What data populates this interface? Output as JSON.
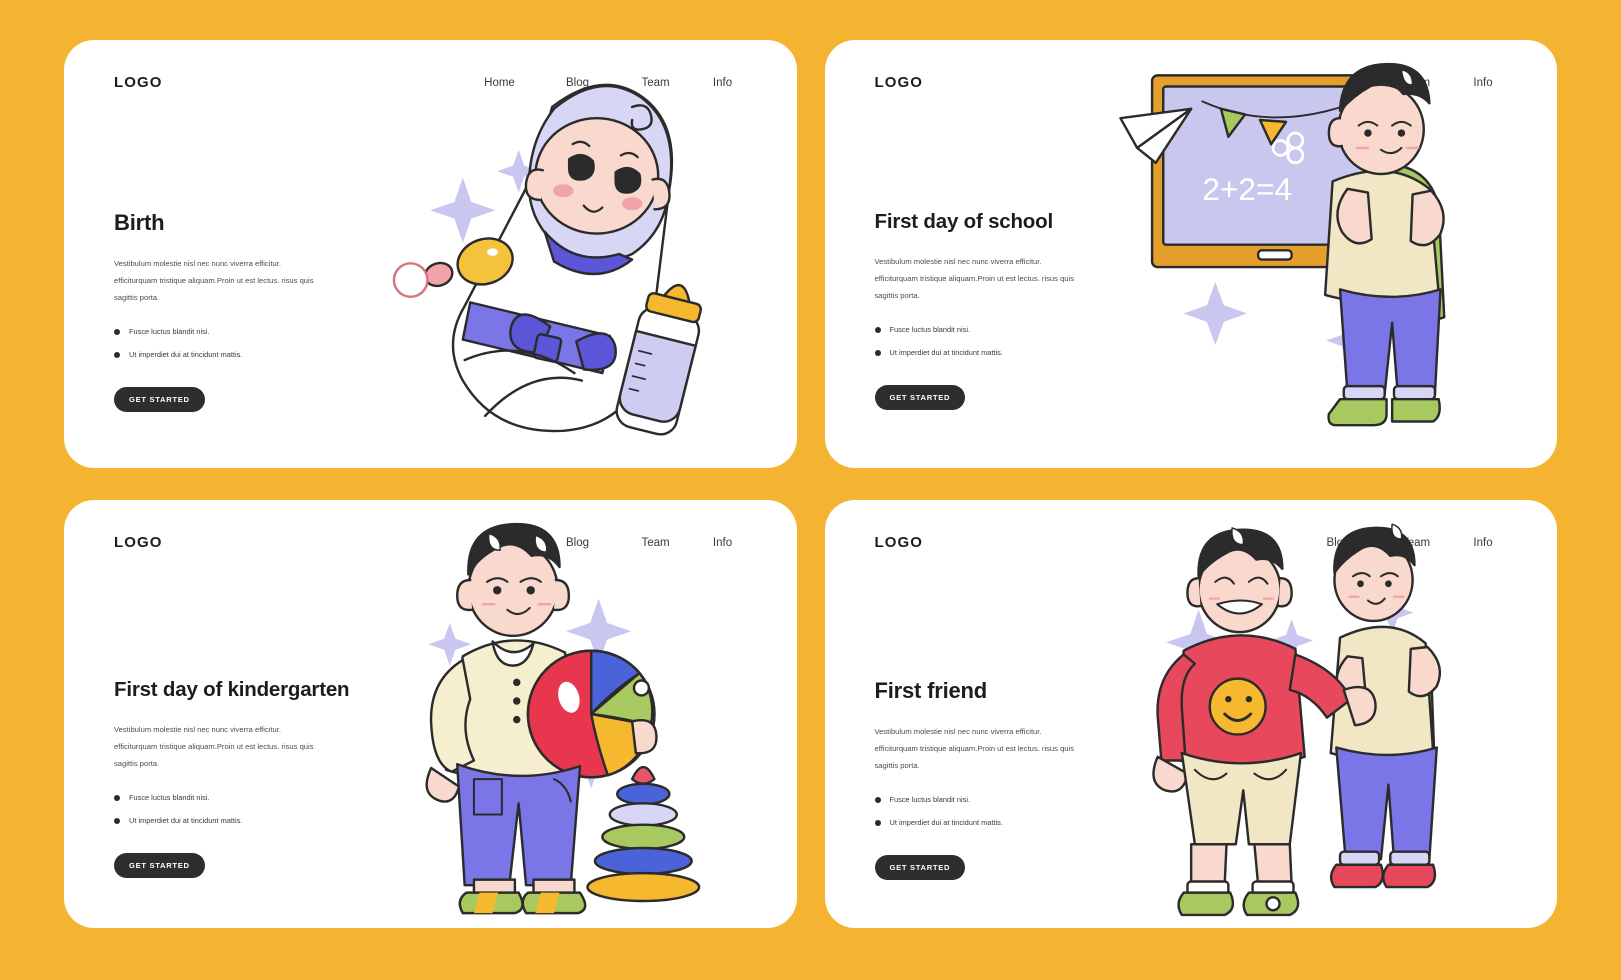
{
  "background_color": "#F4B431",
  "card_color": "#FFFFFF",
  "shared": {
    "logo": "LOGO",
    "nav": [
      "Home",
      "Blog",
      "Team",
      "Info"
    ],
    "paragraph": "Vestibulum molestie nisl nec nunc viverra efficitur. efficiturquam tristique aliquam.Proin ut est lectus. risus quis sagittis porta.",
    "bullets": [
      "Fusce luctus blandit nisi.",
      "Ut imperdiet dui at tincidunt mattis."
    ],
    "cta_label": "GET STARTED",
    "cta_color": "#2E2E2E"
  },
  "cards": [
    {
      "id": "birth",
      "title": "Birth",
      "illustration": "swaddled-baby-with-pacifier-and-bottle",
      "colors": {
        "swaddle": "#FFFFFF",
        "hood": "#D7D6F5",
        "ribbon": "#7B76E8",
        "pacifier": "#F5C33B",
        "pacifier_ring": "#E8808C",
        "bottle_nipple": "#F5B82E",
        "bottle_liquid": "#CFCCF2",
        "skin": "#F9D9CE",
        "sparkle": "#C9C6F0"
      }
    },
    {
      "id": "first-day-of-school",
      "title": "First day of school",
      "illustration": "boy-with-backpack-at-chalkboard",
      "chalkboard_text": "2+2=4",
      "colors": {
        "board_frame": "#E5A02C",
        "board_face": "#C9C7EE",
        "shirt": "#F2E7C4",
        "pants": "#7B76E8",
        "backpack": "#A8C95F",
        "shoes": "#A8C95F",
        "hair": "#2B2B2B",
        "bunting": [
          "#A8C95F",
          "#F5B82E",
          "#E8556A"
        ],
        "sparkle": "#C9C6F0"
      }
    },
    {
      "id": "first-day-of-kindergarten",
      "title": "First day of kindergarten",
      "illustration": "boy-with-beach-ball-and-stacking-toy",
      "colors": {
        "shirt": "#F5EFD0",
        "pants": "#7B76E8",
        "ball": [
          "#E8364F",
          "#4A63D8",
          "#A8C95F",
          "#F5B82E"
        ],
        "pyramid": [
          "#E8556A",
          "#4A63D8",
          "#D7D6F5",
          "#A8C95F",
          "#4A63D8",
          "#F5B82E"
        ],
        "shoes": "#A8C95F",
        "sparkle": "#C9C6F0"
      }
    },
    {
      "id": "first-friend",
      "title": "First friend",
      "illustration": "two-boys-arm-in-arm",
      "colors": {
        "shirt_left": "#E8485C",
        "smiley": "#F5B82E",
        "shorts_left": "#F2E7C4",
        "shirt_right": "#F2E7C4",
        "pants_right": "#7B76E8",
        "backpack": "#A8C95F",
        "shoes_left": "#A8C95F",
        "shoes_right": "#E8485C",
        "sparkle": "#C9C6F0"
      }
    }
  ]
}
